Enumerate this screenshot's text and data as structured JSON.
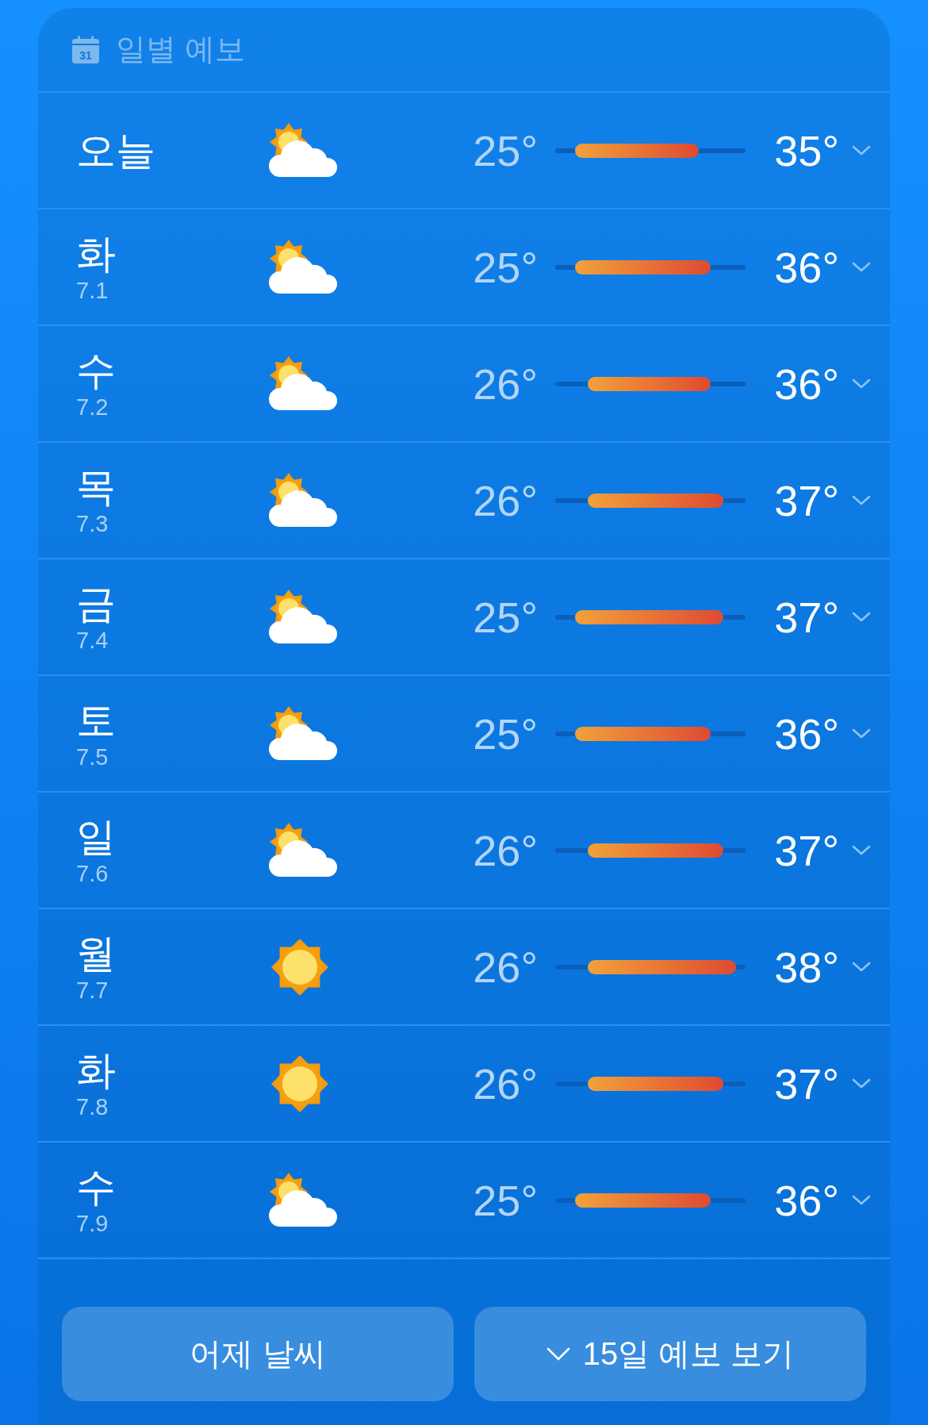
{
  "header": {
    "title": "일별 예보",
    "icon_text": "31"
  },
  "days": [
    {
      "day": "오늘",
      "kind": "partly-cloudy",
      "low": "25°",
      "high": "35°"
    },
    {
      "day": "화",
      "date": "7.1",
      "kind": "partly-cloudy",
      "low": "25°",
      "high": "36°"
    },
    {
      "day": "수",
      "date": "7.2",
      "kind": "partly-cloudy",
      "low": "26°",
      "high": "36°"
    },
    {
      "day": "목",
      "date": "7.3",
      "kind": "partly-cloudy",
      "low": "26°",
      "high": "37°"
    },
    {
      "day": "금",
      "date": "7.4",
      "kind": "partly-cloudy",
      "low": "25°",
      "high": "37°"
    },
    {
      "day": "토",
      "date": "7.5",
      "kind": "partly-cloudy",
      "low": "25°",
      "high": "36°"
    },
    {
      "day": "일",
      "date": "7.6",
      "kind": "partly-cloudy",
      "low": "26°",
      "high": "37°"
    },
    {
      "day": "월",
      "date": "7.7",
      "kind": "sunny",
      "low": "26°",
      "high": "38°"
    },
    {
      "day": "화",
      "date": "7.8",
      "kind": "sunny",
      "low": "26°",
      "high": "37°"
    },
    {
      "day": "수",
      "date": "7.9",
      "kind": "partly-cloudy",
      "low": "25°",
      "high": "36°"
    }
  ],
  "buttons": [
    {
      "label": "어제 날씨",
      "chevron": false
    },
    {
      "label": "15일 예보 보기",
      "chevron": true
    }
  ]
}
